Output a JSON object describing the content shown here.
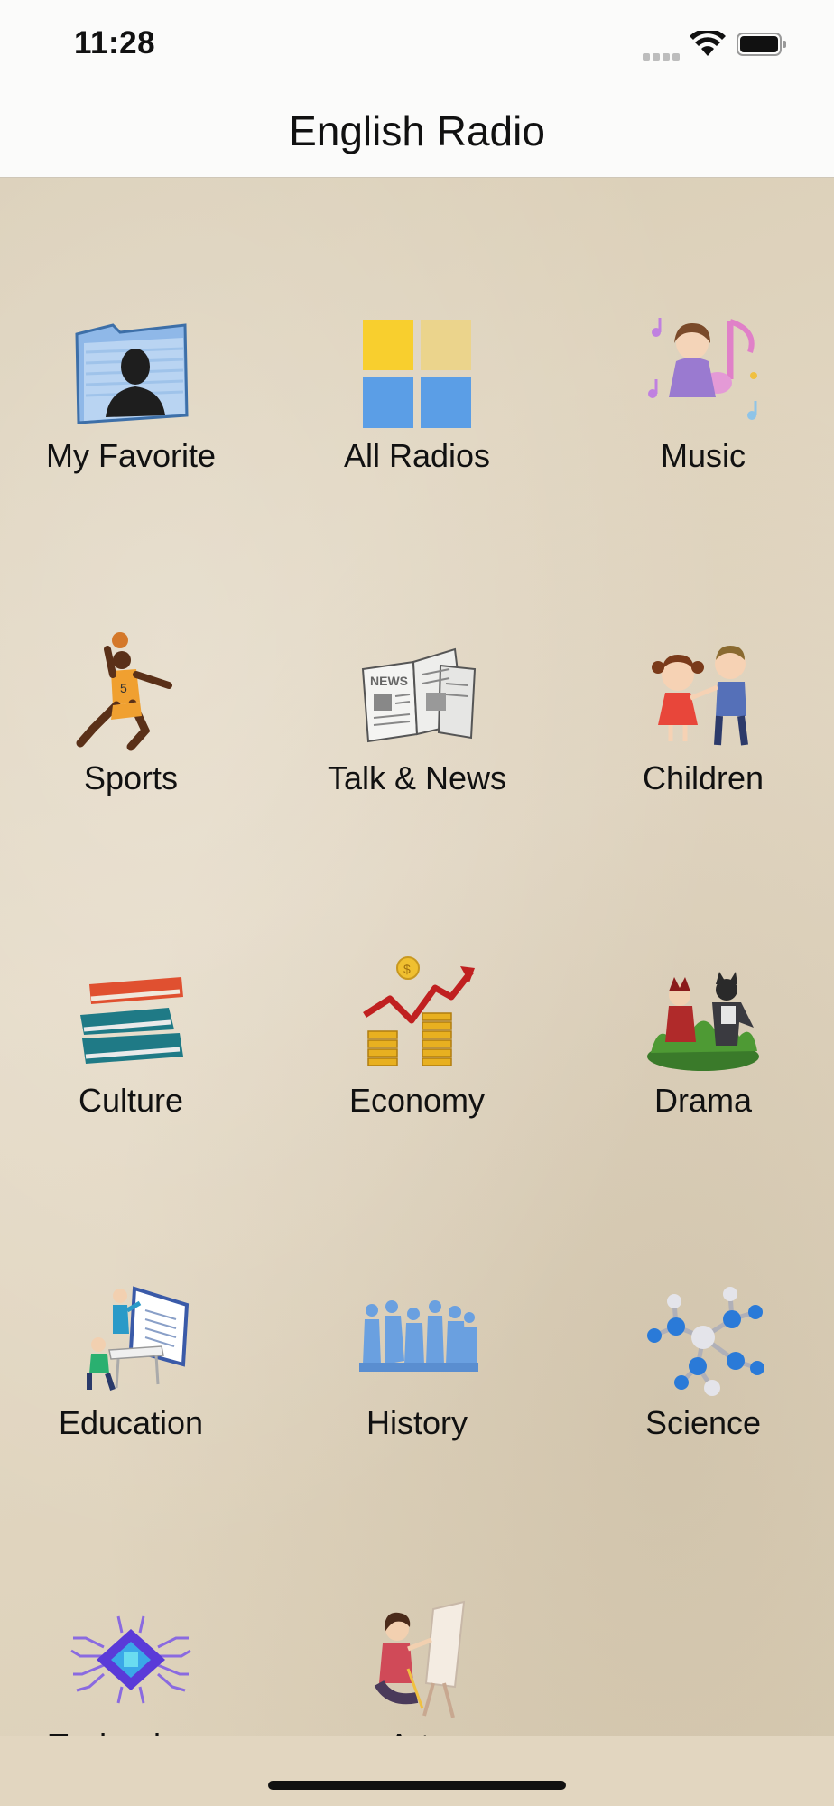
{
  "status": {
    "time": "11:28"
  },
  "header": {
    "title": "English Radio"
  },
  "grid": {
    "items": [
      {
        "label": "My Favorite",
        "icon": "folder-person-icon"
      },
      {
        "label": "All Radios",
        "icon": "grid-squares-icon"
      },
      {
        "label": "Music",
        "icon": "music-girl-icon"
      },
      {
        "label": "Sports",
        "icon": "basketball-player-icon"
      },
      {
        "label": "Talk & News",
        "icon": "newspaper-icon"
      },
      {
        "label": "Children",
        "icon": "children-icon"
      },
      {
        "label": "Culture",
        "icon": "books-icon"
      },
      {
        "label": "Economy",
        "icon": "chart-coins-icon"
      },
      {
        "label": "Drama",
        "icon": "drama-icon"
      },
      {
        "label": "Education",
        "icon": "teacher-board-icon"
      },
      {
        "label": "History",
        "icon": "statues-icon"
      },
      {
        "label": "Science",
        "icon": "molecule-icon"
      },
      {
        "label": "Technology",
        "icon": "chip-icon"
      },
      {
        "label": "Arts",
        "icon": "painter-icon"
      }
    ]
  }
}
